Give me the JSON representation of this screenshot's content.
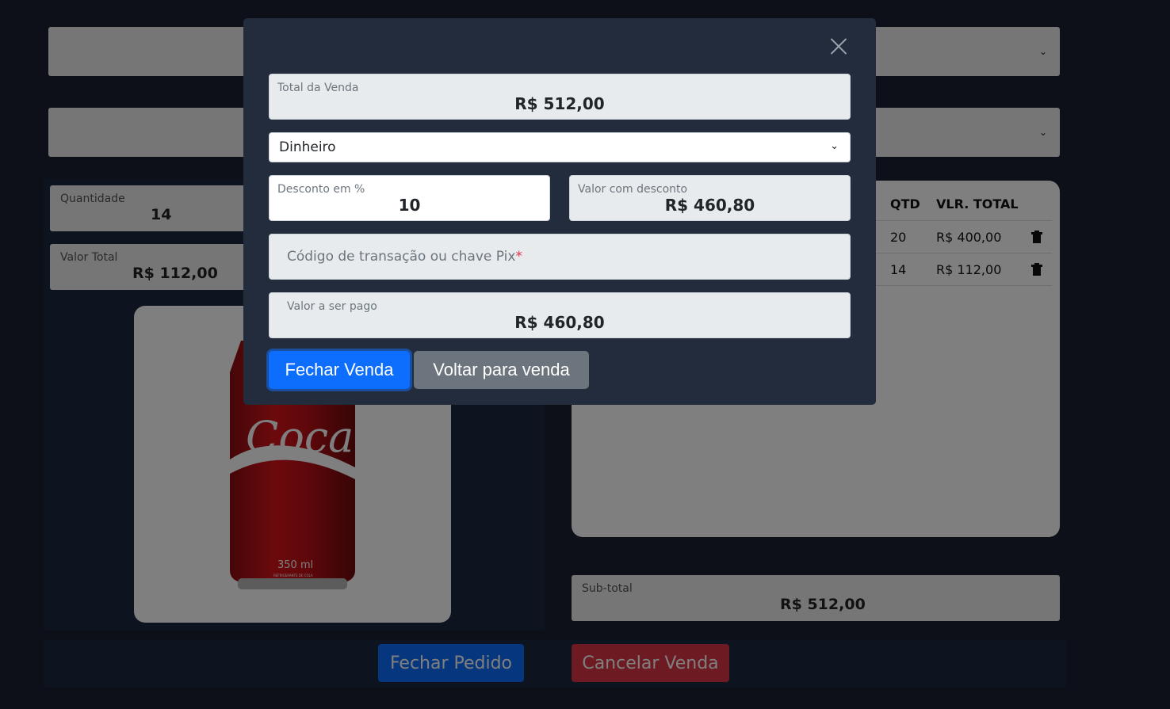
{
  "background": {
    "quantity": {
      "label": "Quantidade",
      "value": "14"
    },
    "total_value": {
      "label": "Valor Total",
      "value": "R$ 112,00"
    },
    "product": {
      "can_text": "350 ml",
      "brand": "Coca-Cola",
      "subtext": "REFRIGERANTE DE COLA"
    },
    "table": {
      "headers": [
        "QTD",
        "VLR. TOTAL"
      ],
      "rows": [
        {
          "qtd": "20",
          "total": "R$ 400,00"
        },
        {
          "qtd": "14",
          "total": "R$ 112,00"
        }
      ]
    },
    "subtotal": {
      "label": "Sub-total",
      "value": "R$ 512,00"
    },
    "buttons": {
      "close_order": "Fechar Pedido",
      "cancel_sale": "Cancelar Venda"
    },
    "colors": {
      "primary": "#0d6efd",
      "danger": "#dc3545"
    }
  },
  "modal": {
    "total": {
      "label": "Total da Venda",
      "value": "R$ 512,00"
    },
    "payment_method": {
      "selected": "Dinheiro"
    },
    "discount": {
      "label": "Desconto em %",
      "value": "10"
    },
    "discounted": {
      "label": "Valor com desconto",
      "value": "R$ 460,80"
    },
    "transaction": {
      "placeholder": "Código de transação ou chave Pix",
      "required_mark": "*"
    },
    "to_pay": {
      "label": "Valor a ser pago",
      "value": "R$ 460,80"
    },
    "buttons": {
      "close_sale": "Fechar Venda",
      "back": "Voltar para venda"
    },
    "close_icon": "close-icon"
  }
}
